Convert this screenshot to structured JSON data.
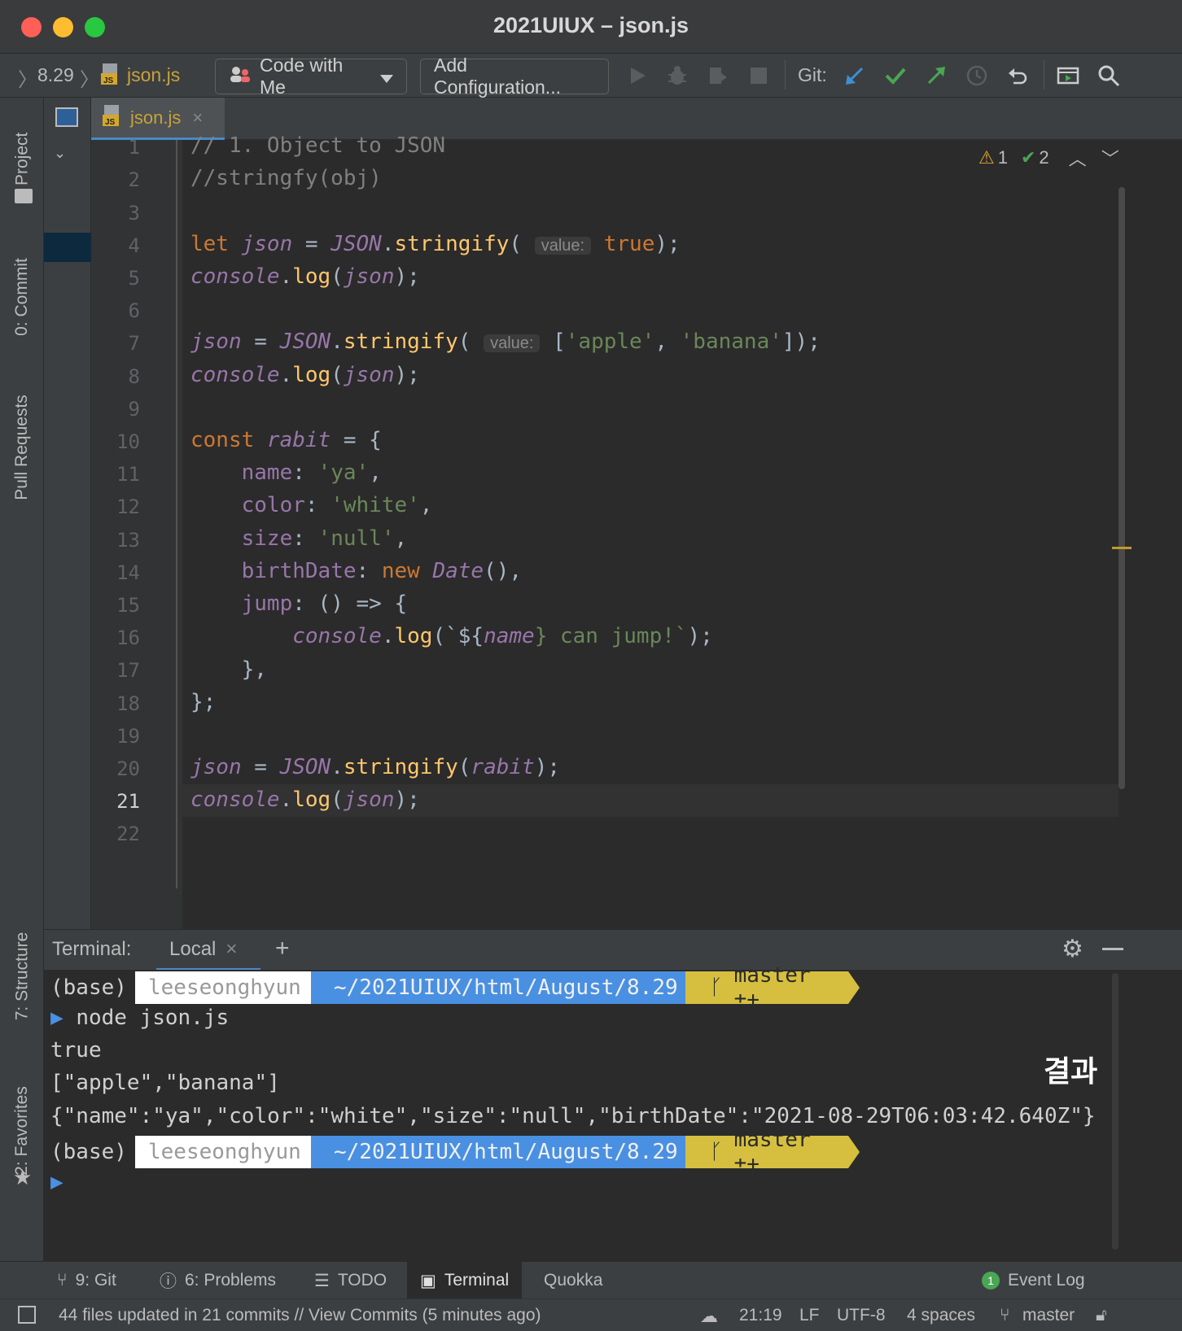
{
  "window": {
    "title": "2021UIUX – json.js"
  },
  "toolbar": {
    "breadcrumb_folder": "8.29",
    "breadcrumb_file": "json.js",
    "code_with_me": "Code with Me",
    "add_configuration": "Add Configuration...",
    "git_label": "Git:"
  },
  "left_tabs": {
    "project": "1: Project",
    "commit": "0: Commit",
    "pull_requests": "Pull Requests",
    "structure": "7: Structure",
    "favorites": "2: Favorites"
  },
  "editor": {
    "tab": "json.js",
    "warnings": "1",
    "checks": "2",
    "current_line": 21,
    "line_numbers": [
      "1",
      "2",
      "3",
      "4",
      "5",
      "6",
      "7",
      "8",
      "9",
      "10",
      "11",
      "12",
      "13",
      "14",
      "15",
      "16",
      "17",
      "18",
      "19",
      "20",
      "21",
      "22"
    ],
    "hints": {
      "value": "value:"
    },
    "code": {
      "l1": "// 1. Object to JSON",
      "l2": "//stringfy(obj)",
      "l4_let": "let ",
      "l4_json": "json",
      "l4_eq": " = ",
      "l4_JSON": "JSON",
      "l4_dot": ".",
      "l4_fn": "stringify",
      "l4_open": "( ",
      "l4_true": "true",
      "l4_close": ");",
      "console": "console",
      "log": "log",
      "json": "json",
      "semi_close": ");",
      "open_paren": "(",
      "dot": ".",
      "l7_arr_open": "[",
      "l7_apple": "'apple'",
      "l7_comma": ", ",
      "l7_banana": "'banana'",
      "l7_close": "]);",
      "l10_const": "const ",
      "l10_rabit": "rabit",
      "l10_rest": " = {",
      "l11_key": "name",
      "l11_colon": ": ",
      "l11_val": "'ya'",
      "l11_comma": ",",
      "l12_key": "color",
      "l12_val": "'white'",
      "l13_key": "size",
      "l13_val": "'null'",
      "l14_key": "birthDate",
      "l14_new": "new ",
      "l14_date": "Date",
      "l14_rest": "(),",
      "l15_key": "jump",
      "l15_rest": ": () => {",
      "l16_tick": "`${",
      "l16_name": "name",
      "l16_rest": "} can jump!`",
      "l17": "},",
      "l18": "};",
      "l20_rabit": "rabit"
    }
  },
  "terminal": {
    "label": "Terminal:",
    "tab": "Local",
    "prompt_base": "(base)",
    "prompt_user": "leeseonghyun",
    "prompt_path": "~/2021UIUX/html/August/8.29",
    "prompt_branch": "master ±+",
    "command": "node json.js",
    "output": [
      "true",
      "[\"apple\",\"banana\"]",
      "{\"name\":\"ya\",\"color\":\"white\",\"size\":\"null\",\"birthDate\":\"2021-08-29T06:03:42.640Z\"}"
    ],
    "annotation": "결과"
  },
  "bottom_tabs": {
    "git": "9: Git",
    "problems": "6: Problems",
    "todo": "TODO",
    "terminal": "Terminal",
    "quokka": "Quokka",
    "event_log_count": "1",
    "event_log": "Event Log"
  },
  "status": {
    "message": "44 files updated in 21 commits // View Commits (5 minutes ago)",
    "position": "21:19",
    "line_sep": "LF",
    "encoding": "UTF-8",
    "indent": "4 spaces",
    "branch": "master"
  },
  "colors": {
    "keyword": "#cc7832",
    "string": "#6a8759",
    "function": "#ffc66d",
    "variable": "#9876aa",
    "comment": "#808080",
    "path_segment": "#4a90e2",
    "branch_segment": "#d6bf3f"
  }
}
